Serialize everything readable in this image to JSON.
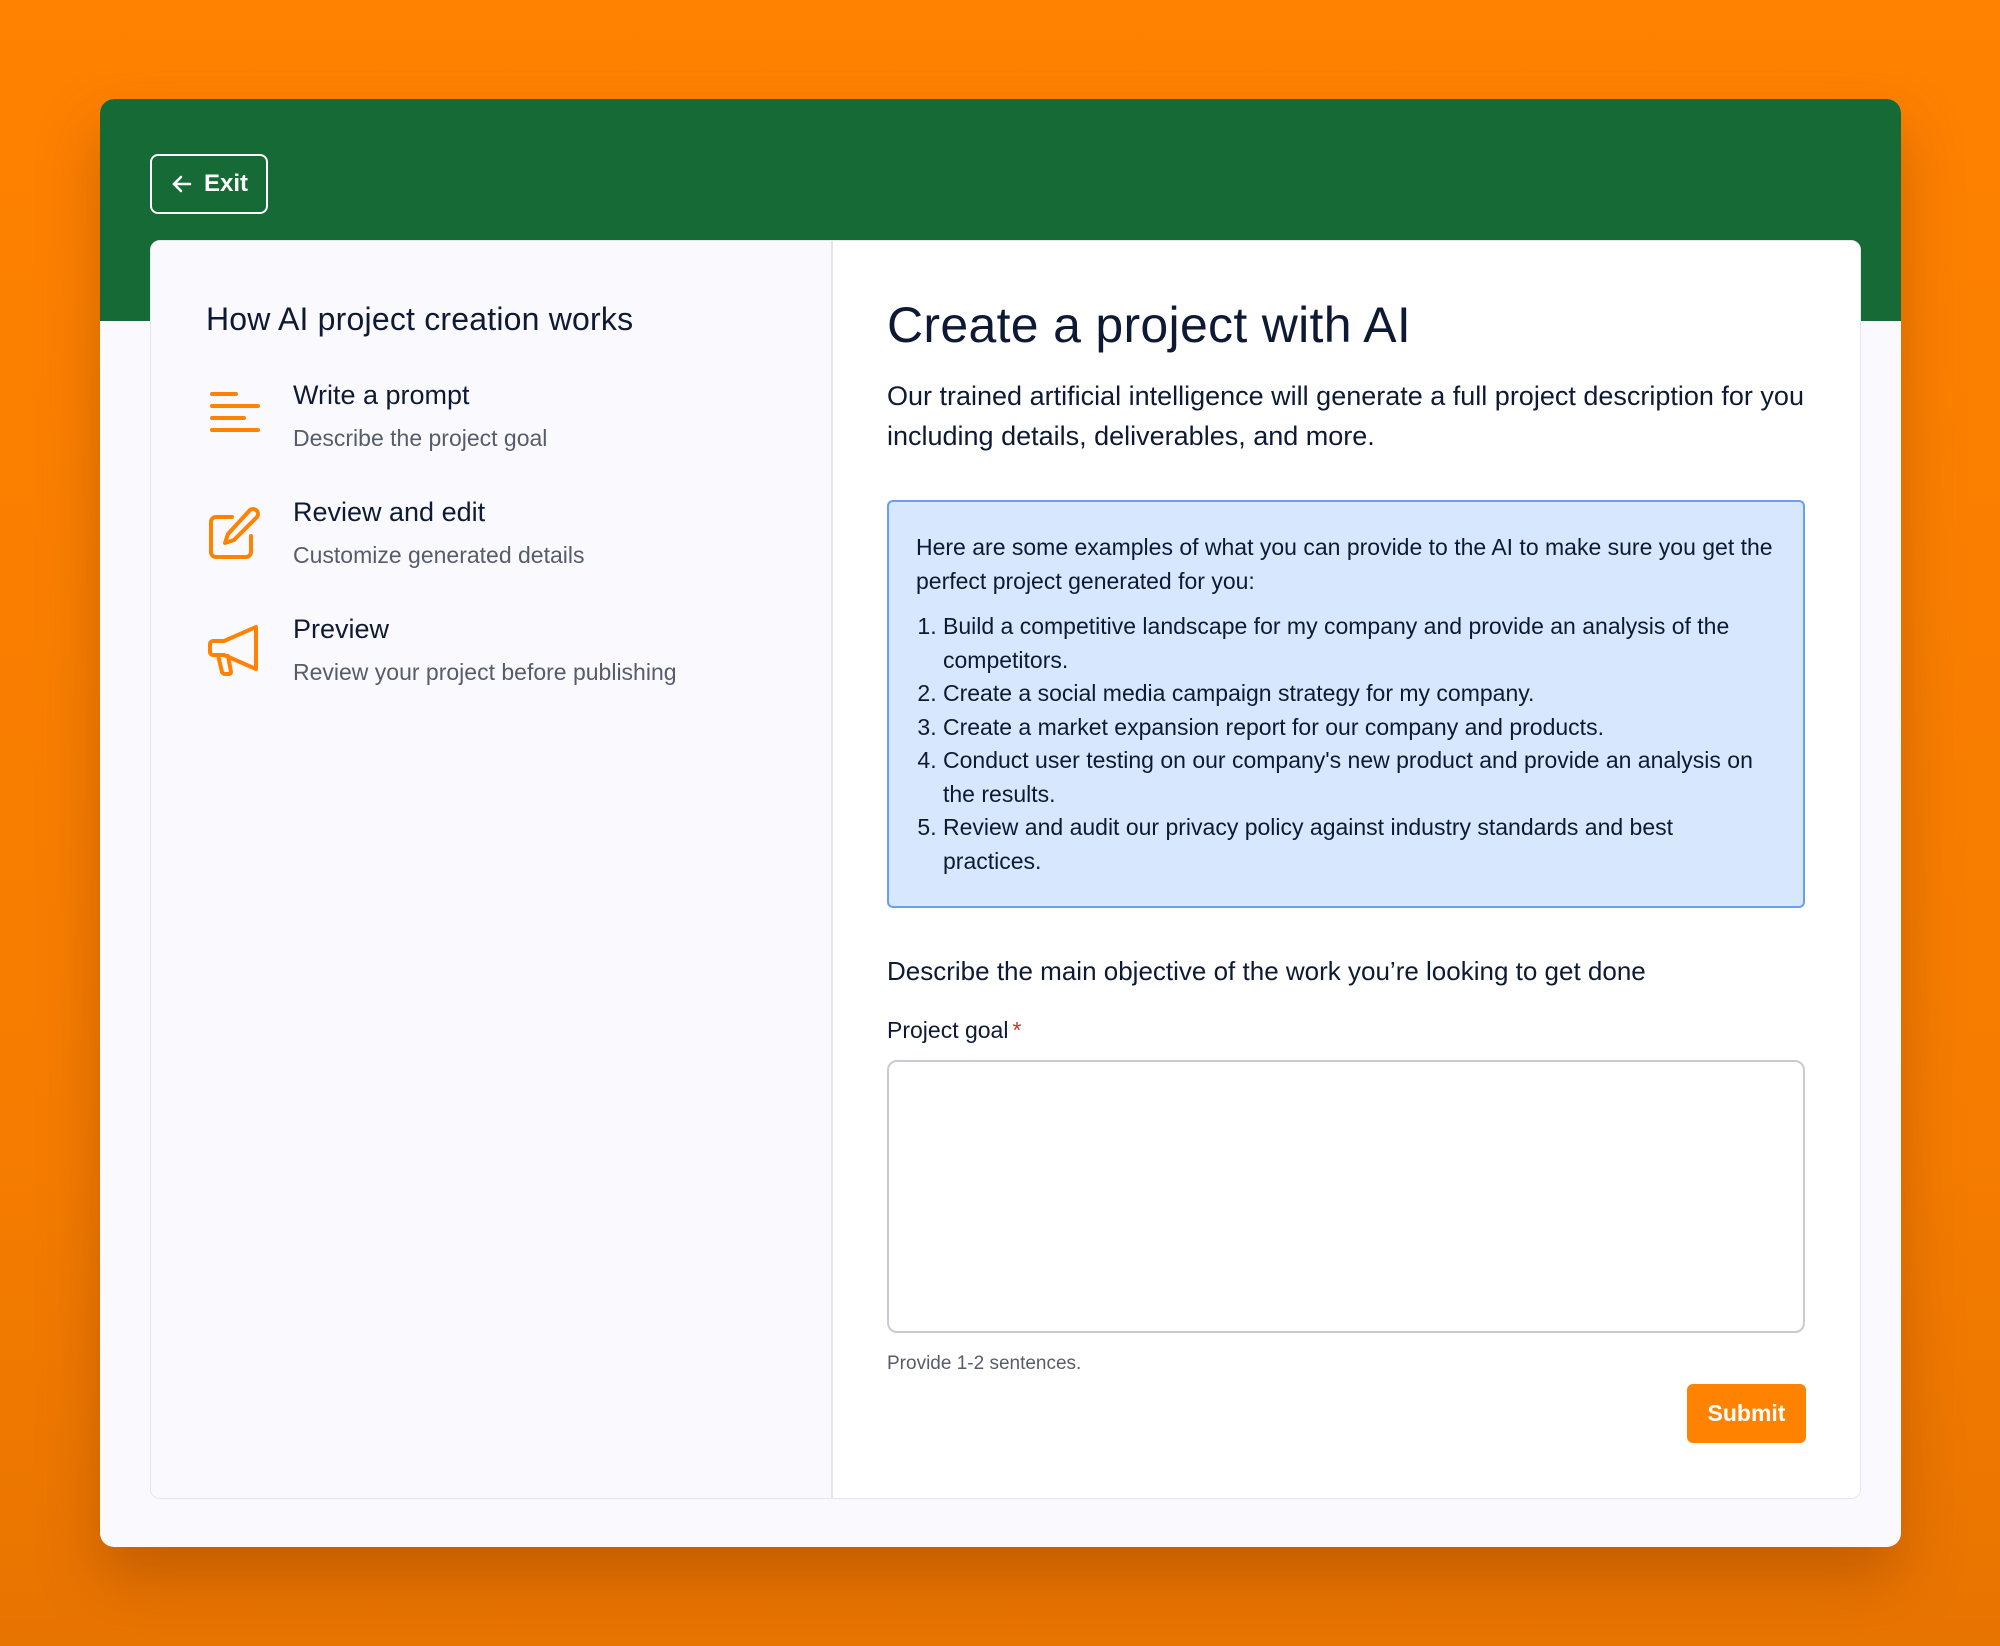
{
  "header": {
    "exit_label": "Exit",
    "accent": "#166a36"
  },
  "sidebar": {
    "title": "How AI project creation works",
    "steps": [
      {
        "icon": "text-lines-icon",
        "title": "Write a prompt",
        "description": "Describe the project goal"
      },
      {
        "icon": "edit-pencil-icon",
        "title": "Review and edit",
        "description": "Customize generated details"
      },
      {
        "icon": "megaphone-icon",
        "title": "Preview",
        "description": "Review your project before publishing"
      }
    ]
  },
  "main": {
    "title": "Create a project with AI",
    "intro": "Our trained artificial intelligence will generate a full project description for you including details, deliverables, and more.",
    "examples": {
      "lead": "Here are some examples of what you can provide to the AI to make sure you get the perfect project generated for you:",
      "items": [
        "Build a competitive landscape for my company and provide an analysis of the competitors.",
        "Create a social media campaign strategy for my company.",
        "Create a market expansion report for our company and products.",
        "Conduct user testing on our company's new product and provide an analysis on the results.",
        "Review and audit our privacy policy against industry standards and best practices."
      ]
    },
    "objective_heading": "Describe the main objective of the work you’re looking to get done",
    "goal_label": "Project goal",
    "required_marker": "*",
    "goal_value": "",
    "hint": "Provide 1-2 sentences.",
    "submit_label": "Submit"
  },
  "colors": {
    "background": "#ff8200",
    "header": "#166a36",
    "icon_accent": "#ff8200",
    "examples_bg": "#d7e7fd",
    "examples_border": "#6a9ff0",
    "submit": "#ff8200"
  }
}
